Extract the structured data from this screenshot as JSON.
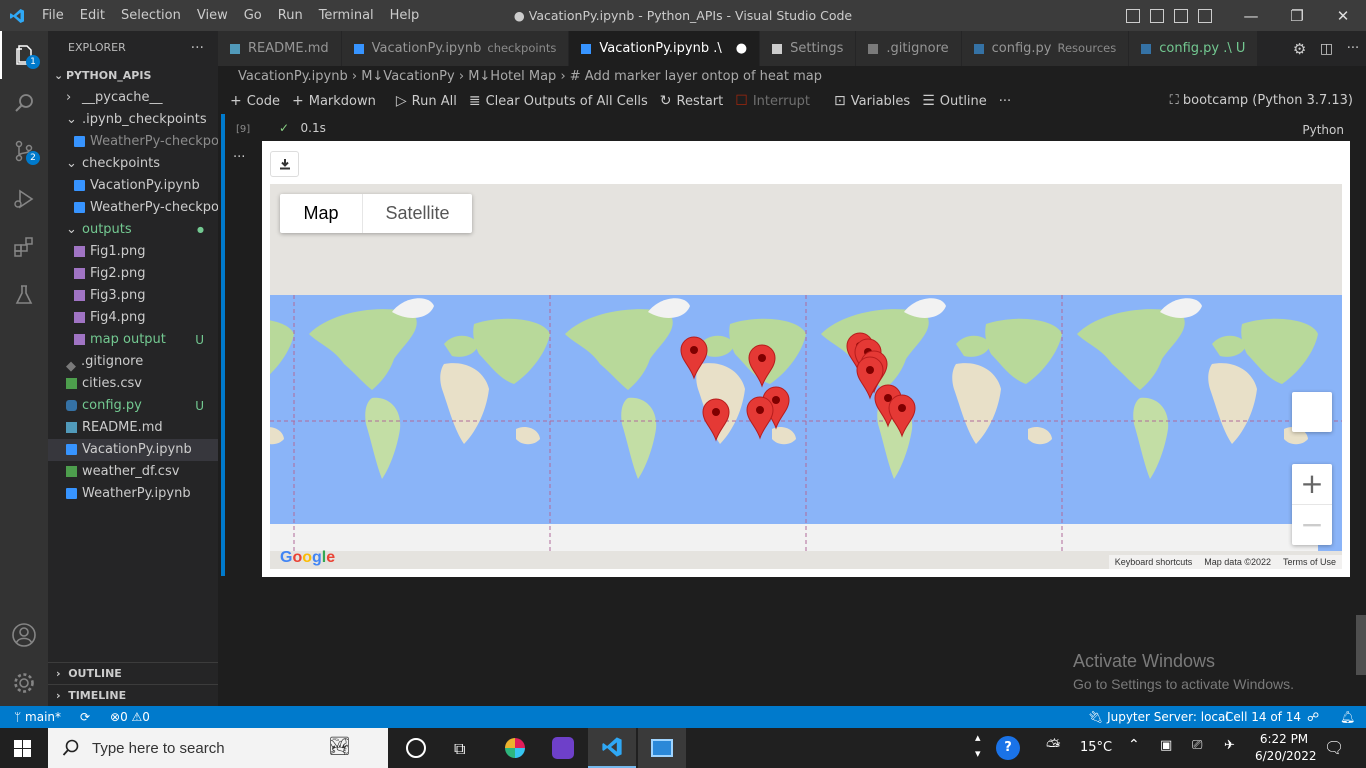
{
  "window": {
    "title": "● VacationPy.ipynb - Python_APIs - Visual Studio Code",
    "menu": [
      "File",
      "Edit",
      "Selection",
      "View",
      "Go",
      "Run",
      "Terminal",
      "Help"
    ]
  },
  "activity_bar": {
    "explorer_badge": "1",
    "scm_badge": "2"
  },
  "sidebar": {
    "header": "EXPLORER",
    "more": "···",
    "root": "PYTHON_APIS",
    "items": [
      {
        "label": "__pycache__",
        "indent": 1,
        "type": "folder",
        "state": "collapsed",
        "color": "#cccccc"
      },
      {
        "label": ".ipynb_checkpoints",
        "indent": 1,
        "type": "folder",
        "state": "expanded",
        "color": "#cccccc"
      },
      {
        "label": "WeatherPy-checkpoi...",
        "indent": 2,
        "type": "notebook",
        "color": "#8b8b8b"
      },
      {
        "label": "checkpoints",
        "indent": 1,
        "type": "folder",
        "state": "expanded",
        "color": "#cccccc"
      },
      {
        "label": "VacationPy.ipynb",
        "indent": 2,
        "type": "notebook",
        "color": "#cccccc"
      },
      {
        "label": "WeatherPy-checkpoi...",
        "indent": 2,
        "type": "notebook",
        "color": "#cccccc"
      },
      {
        "label": "outputs",
        "indent": 1,
        "type": "folder",
        "state": "expanded",
        "color": "#73c991",
        "dot": true
      },
      {
        "label": "Fig1.png",
        "indent": 2,
        "type": "image",
        "color": "#cccccc"
      },
      {
        "label": "Fig2.png",
        "indent": 2,
        "type": "image",
        "color": "#cccccc"
      },
      {
        "label": "Fig3.png",
        "indent": 2,
        "type": "image",
        "color": "#cccccc"
      },
      {
        "label": "Fig4.png",
        "indent": 2,
        "type": "image",
        "color": "#cccccc"
      },
      {
        "label": "map output",
        "indent": 2,
        "type": "image",
        "color": "#73c991",
        "status": "U"
      },
      {
        "label": ".gitignore",
        "indent": 1,
        "type": "git",
        "color": "#cccccc"
      },
      {
        "label": "cities.csv",
        "indent": 1,
        "type": "csv",
        "color": "#cccccc"
      },
      {
        "label": "config.py",
        "indent": 1,
        "type": "python",
        "color": "#73c991",
        "status": "U"
      },
      {
        "label": "README.md",
        "indent": 1,
        "type": "md",
        "color": "#cccccc"
      },
      {
        "label": "VacationPy.ipynb",
        "indent": 1,
        "type": "notebook",
        "color": "#cccccc",
        "selected": true
      },
      {
        "label": "weather_df.csv",
        "indent": 1,
        "type": "csv",
        "color": "#cccccc"
      },
      {
        "label": "WeatherPy.ipynb",
        "indent": 1,
        "type": "notebook",
        "color": "#cccccc"
      }
    ],
    "outline": "OUTLINE",
    "timeline": "TIMELINE"
  },
  "tabs": [
    {
      "label": "README.md",
      "desc": "",
      "icon": "md-icon",
      "active": false
    },
    {
      "label": "VacationPy.ipynb",
      "desc": "checkpoints",
      "icon": "notebook-icon",
      "active": false
    },
    {
      "label": "VacationPy.ipynb .\\",
      "desc": "",
      "icon": "notebook-icon",
      "active": true,
      "dirty": "●"
    },
    {
      "label": "Settings",
      "desc": "",
      "icon": "settings-icon",
      "active": false
    },
    {
      "label": ".gitignore",
      "desc": "",
      "icon": "git-icon",
      "active": false
    },
    {
      "label": "config.py",
      "desc": "Resources",
      "icon": "python-icon",
      "active": false
    },
    {
      "label": "config.py .\\ U",
      "desc": "",
      "icon": "python-icon",
      "active": false,
      "green": true
    }
  ],
  "breadcrumbs": [
    "VacationPy.ipynb",
    "M↓VacationPy",
    "M↓Hotel Map",
    "# Add marker layer ontop of heat map"
  ],
  "toolbar": {
    "code": "Code",
    "markdown": "Markdown",
    "run_all": "Run All",
    "clear": "Clear Outputs of All Cells",
    "restart": "Restart",
    "interrupt": "Interrupt",
    "variables": "Variables",
    "outline": "Outline",
    "more": "···",
    "kernel": "bootcamp (Python 3.7.13)"
  },
  "cell": {
    "exec_count": "[9]",
    "duration": "0.1s",
    "language": "Python",
    "more": "···"
  },
  "map": {
    "map_btn": "Map",
    "satellite_btn": "Satellite",
    "zoom_in": "+",
    "zoom_out": "−",
    "google": "Google",
    "keyboard": "Keyboard shortcuts",
    "mapdata": "Map data ©2022",
    "terms": "Terms of Use",
    "marker_color": "#e53935"
  },
  "watermark": {
    "title": "Activate Windows",
    "sub": "Go to Settings to activate Windows."
  },
  "status": {
    "branch": "main*",
    "errors": "0",
    "warnings": "0",
    "jupyter": "Jupyter Server: local",
    "cell": "Cell 14 of 14"
  },
  "taskbar": {
    "search": "Type here to search",
    "temp": "15°C",
    "time": "6:22 PM",
    "date": "6/20/2022"
  }
}
